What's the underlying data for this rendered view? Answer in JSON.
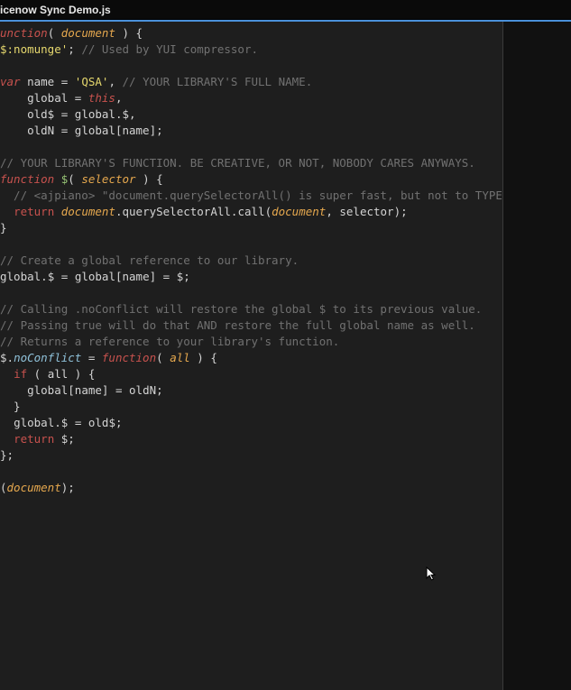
{
  "tab": {
    "title": "icenow Sync Demo.js"
  },
  "code": {
    "lines": [
      [
        {
          "cls": "kw-func",
          "t": "unction"
        },
        {
          "cls": "punct",
          "t": "( "
        },
        {
          "cls": "param",
          "t": "document"
        },
        {
          "cls": "punct",
          "t": " ) {"
        }
      ],
      [
        {
          "cls": "str",
          "t": "$:nomunge'"
        },
        {
          "cls": "punct",
          "t": "; "
        },
        {
          "cls": "comment",
          "t": "// Used by YUI compressor."
        }
      ],
      [],
      [
        {
          "cls": "kw-var",
          "t": "var"
        },
        {
          "cls": "ident",
          "t": " name "
        },
        {
          "cls": "punct",
          "t": "= "
        },
        {
          "cls": "str",
          "t": "'QSA'"
        },
        {
          "cls": "punct",
          "t": ", "
        },
        {
          "cls": "comment",
          "t": "// YOUR LIBRARY'S FULL NAME."
        }
      ],
      [
        {
          "cls": "ident",
          "t": "    global "
        },
        {
          "cls": "punct",
          "t": "= "
        },
        {
          "cls": "kw-this",
          "t": "this"
        },
        {
          "cls": "punct",
          "t": ","
        }
      ],
      [
        {
          "cls": "ident",
          "t": "    old$ "
        },
        {
          "cls": "punct",
          "t": "= "
        },
        {
          "cls": "glob",
          "t": "global"
        },
        {
          "cls": "punct",
          "t": "."
        },
        {
          "cls": "ident",
          "t": "$"
        },
        {
          "cls": "punct",
          "t": ","
        }
      ],
      [
        {
          "cls": "ident",
          "t": "    oldN "
        },
        {
          "cls": "punct",
          "t": "= "
        },
        {
          "cls": "glob",
          "t": "global"
        },
        {
          "cls": "punct",
          "t": "["
        },
        {
          "cls": "ident",
          "t": "name"
        },
        {
          "cls": "punct",
          "t": "];"
        }
      ],
      [],
      [
        {
          "cls": "comment",
          "t": "// YOUR LIBRARY'S FUNCTION. BE CREATIVE, OR NOT, NOBODY CARES ANYWAYS."
        }
      ],
      [
        {
          "cls": "kw-func",
          "t": "function"
        },
        {
          "cls": "ident",
          "t": " "
        },
        {
          "cls": "func-name",
          "t": "$"
        },
        {
          "cls": "punct",
          "t": "( "
        },
        {
          "cls": "param",
          "t": "selector"
        },
        {
          "cls": "punct",
          "t": " ) {"
        }
      ],
      [
        {
          "cls": "comment",
          "t": "  // <ajpiano> \"document.querySelectorAll() is super fast, but not to TYPE\""
        }
      ],
      [
        {
          "cls": "ident",
          "t": "  "
        },
        {
          "cls": "kw-return",
          "t": "return"
        },
        {
          "cls": "ident",
          "t": " "
        },
        {
          "cls": "tok-doc",
          "t": "document"
        },
        {
          "cls": "punct",
          "t": "."
        },
        {
          "cls": "ident",
          "t": "querySelectorAll"
        },
        {
          "cls": "punct",
          "t": "."
        },
        {
          "cls": "ident",
          "t": "call"
        },
        {
          "cls": "punct",
          "t": "("
        },
        {
          "cls": "tok-doc",
          "t": "document"
        },
        {
          "cls": "punct",
          "t": ", selector);"
        }
      ],
      [
        {
          "cls": "punct",
          "t": "}"
        }
      ],
      [],
      [
        {
          "cls": "comment",
          "t": "// Create a global reference to our library."
        }
      ],
      [
        {
          "cls": "glob",
          "t": "global"
        },
        {
          "cls": "punct",
          "t": "."
        },
        {
          "cls": "ident",
          "t": "$ "
        },
        {
          "cls": "punct",
          "t": "= "
        },
        {
          "cls": "glob",
          "t": "global"
        },
        {
          "cls": "punct",
          "t": "["
        },
        {
          "cls": "ident",
          "t": "name"
        },
        {
          "cls": "punct",
          "t": "] "
        },
        {
          "cls": "punct",
          "t": "= "
        },
        {
          "cls": "ident",
          "t": "$"
        },
        {
          "cls": "punct",
          "t": ";"
        }
      ],
      [],
      [
        {
          "cls": "comment",
          "t": "// Calling .noConflict will restore the global $ to its previous value."
        }
      ],
      [
        {
          "cls": "comment",
          "t": "// Passing true will do that AND restore the full global name as well."
        }
      ],
      [
        {
          "cls": "comment",
          "t": "// Returns a reference to your library's function."
        }
      ],
      [
        {
          "cls": "ident",
          "t": "$"
        },
        {
          "cls": "punct",
          "t": "."
        },
        {
          "cls": "prop",
          "t": "noConflict"
        },
        {
          "cls": "punct",
          "t": " = "
        },
        {
          "cls": "kw-func",
          "t": "function"
        },
        {
          "cls": "punct",
          "t": "( "
        },
        {
          "cls": "param",
          "t": "all"
        },
        {
          "cls": "punct",
          "t": " ) {"
        }
      ],
      [
        {
          "cls": "ident",
          "t": "  "
        },
        {
          "cls": "kw-if",
          "t": "if"
        },
        {
          "cls": "punct",
          "t": " ( all ) {"
        }
      ],
      [
        {
          "cls": "ident",
          "t": "    "
        },
        {
          "cls": "glob",
          "t": "global"
        },
        {
          "cls": "punct",
          "t": "["
        },
        {
          "cls": "ident",
          "t": "name"
        },
        {
          "cls": "punct",
          "t": "] "
        },
        {
          "cls": "punct",
          "t": "= "
        },
        {
          "cls": "ident",
          "t": "oldN"
        },
        {
          "cls": "punct",
          "t": ";"
        }
      ],
      [
        {
          "cls": "punct",
          "t": "  }"
        }
      ],
      [
        {
          "cls": "ident",
          "t": "  "
        },
        {
          "cls": "glob",
          "t": "global"
        },
        {
          "cls": "punct",
          "t": "."
        },
        {
          "cls": "ident",
          "t": "$ "
        },
        {
          "cls": "punct",
          "t": "= "
        },
        {
          "cls": "ident",
          "t": "old$"
        },
        {
          "cls": "punct",
          "t": ";"
        }
      ],
      [
        {
          "cls": "ident",
          "t": "  "
        },
        {
          "cls": "kw-return",
          "t": "return"
        },
        {
          "cls": "ident",
          "t": " $"
        },
        {
          "cls": "punct",
          "t": ";"
        }
      ],
      [
        {
          "cls": "punct",
          "t": "};"
        }
      ],
      [],
      [
        {
          "cls": "punct",
          "t": "("
        },
        {
          "cls": "tok-doc",
          "t": "document"
        },
        {
          "cls": "punct",
          "t": ");"
        }
      ]
    ]
  }
}
